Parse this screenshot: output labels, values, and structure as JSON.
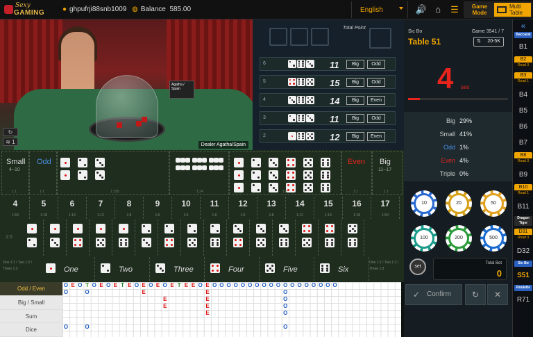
{
  "header": {
    "logo_text_1": "Sexy",
    "logo_text_2": "GAMING",
    "username": "ghpufrji88snb1009",
    "balance_label": "Balance",
    "balance_value": "585.00",
    "language": "English",
    "icons": [
      "sound-icon",
      "home-icon",
      "menu-icon"
    ],
    "game_mode_label": "Game Mode",
    "multi_table_label": "Multi Table"
  },
  "video": {
    "dealer_tag": "Dealer Agatha/Spain",
    "card_text": "Agatha / Spain",
    "wifi_level": "1"
  },
  "results": {
    "total_point_label": "Total Point",
    "history": [
      {
        "round": "6",
        "dice": [
          2,
          6,
          3
        ],
        "sum": "11",
        "size": "Big",
        "parity": "Odd"
      },
      {
        "round": "5",
        "dice": [
          4,
          6,
          5
        ],
        "sum": "15",
        "size": "Big",
        "parity": "Odd"
      },
      {
        "round": "4",
        "dice": [
          3,
          6,
          5
        ],
        "sum": "14",
        "size": "Big",
        "parity": "Even"
      },
      {
        "round": "3",
        "dice": [
          2,
          6,
          3
        ],
        "sum": "11",
        "size": "Big",
        "parity": "Odd"
      },
      {
        "round": "2",
        "dice": [
          1,
          6,
          5
        ],
        "sum": "12",
        "size": "Big",
        "parity": "Even"
      }
    ]
  },
  "board": {
    "small_label": "Small",
    "small_range": "4~10",
    "odd_label": "Odd",
    "even_label": "Even",
    "big_label": "Big",
    "big_range": "11~17",
    "payout_1_1": "1:1",
    "payout_1_8": "1:8",
    "payout_1_24": "1:24",
    "payout_1_150": "1:150",
    "payout_1_5": "1:5",
    "totals": [
      {
        "v": "4",
        "p": "1:50"
      },
      {
        "v": "5",
        "p": "1:18"
      },
      {
        "v": "6",
        "p": "1:14"
      },
      {
        "v": "7",
        "p": "1:12"
      },
      {
        "v": "8",
        "p": "1:8"
      },
      {
        "v": "9",
        "p": "1:6"
      },
      {
        "v": "10",
        "p": "1:6"
      },
      {
        "v": "11",
        "p": "1:6"
      },
      {
        "v": "12",
        "p": "1:6"
      },
      {
        "v": "13",
        "p": "1:8"
      },
      {
        "v": "14",
        "p": "1:12"
      },
      {
        "v": "15",
        "p": "1:14"
      },
      {
        "v": "16",
        "p": "1:18"
      },
      {
        "v": "17",
        "p": "1:50"
      }
    ],
    "single_payout_text": "One 1:1 / Two 1:2 / Three 1:3",
    "singles": [
      "One",
      "Two",
      "Three",
      "Four",
      "Five",
      "Six"
    ]
  },
  "roadmap": {
    "tabs": [
      "Odd / Even",
      "Big / Small",
      "Sum",
      "Dice"
    ],
    "active_tab": "Odd / Even",
    "row1": [
      "O",
      "E",
      "O",
      "T",
      "O",
      "E",
      "O",
      "E",
      "T",
      "E",
      "O",
      "E",
      "O",
      "E",
      "O",
      "E",
      "T",
      "E",
      "E",
      "O",
      "E",
      "O",
      "O",
      "O",
      "O",
      "O",
      "O",
      "O",
      "O",
      "O",
      "O",
      "O",
      "O",
      "O",
      "O",
      "O",
      "O",
      "O",
      "O"
    ]
  },
  "table": {
    "game_type": "Sic Bo",
    "table_name": "Table 51",
    "game_no": "Game 3541 / 7",
    "limit": "20-5K",
    "countdown": "4",
    "countdown_unit": "sec",
    "countdown_fraction": 0.12
  },
  "stats": [
    {
      "label": "Big",
      "value": "29%",
      "color": "#cccccc"
    },
    {
      "label": "Small",
      "value": "41%",
      "color": "#cccccc"
    },
    {
      "label": "Odd",
      "value": "1%",
      "color": "#4a90e2"
    },
    {
      "label": "Even",
      "value": "4%",
      "color": "#e8241c"
    },
    {
      "label": "Triple",
      "value": "0%",
      "color": "#cccccc"
    }
  ],
  "chips": [
    {
      "value": "10",
      "color": "#2a6ad0"
    },
    {
      "value": "20",
      "color": "#d4a017"
    },
    {
      "value": "50",
      "color": "#e0a020"
    },
    {
      "value": "100",
      "color": "#1a9a8a"
    },
    {
      "value": "200",
      "color": "#2a9a3a"
    },
    {
      "value": "500",
      "color": "#1a6ad0"
    }
  ],
  "controls": {
    "set_label": "set",
    "total_bet_label": "Total Bet",
    "total_bet_value": "0",
    "confirm_label": "Confirm"
  },
  "sidebar": {
    "items": [
      {
        "label": "«",
        "kind": "icon"
      },
      {
        "label": "Baccarat",
        "kind": "tag",
        "color": "#2a60c0"
      },
      {
        "label": "B1",
        "kind": "item"
      },
      {
        "label": "B2",
        "kind": "item",
        "badge": "Road 3"
      },
      {
        "label": "B3",
        "kind": "item",
        "badge": "Road 1"
      },
      {
        "label": "B4",
        "kind": "item"
      },
      {
        "label": "B5",
        "kind": "item"
      },
      {
        "label": "B6",
        "kind": "item"
      },
      {
        "label": "B7",
        "kind": "item"
      },
      {
        "label": "B8",
        "kind": "item",
        "badge": "Road 3"
      },
      {
        "label": "B9",
        "kind": "item"
      },
      {
        "label": "B10",
        "kind": "item",
        "badge": "Road 1"
      },
      {
        "label": "B11",
        "kind": "item"
      },
      {
        "label": "Dragon Tiger",
        "kind": "tag",
        "color": "#2a2a2a"
      },
      {
        "label": "D31",
        "kind": "item",
        "badge": "Road 3"
      },
      {
        "label": "D32",
        "kind": "item"
      },
      {
        "label": "Sic Bo",
        "kind": "tag",
        "color": "#2a60c0"
      },
      {
        "label": "S51",
        "kind": "item",
        "active": true
      },
      {
        "label": "Roulette",
        "kind": "tag",
        "color": "#2a60c0"
      },
      {
        "label": "R71",
        "kind": "item"
      }
    ]
  }
}
